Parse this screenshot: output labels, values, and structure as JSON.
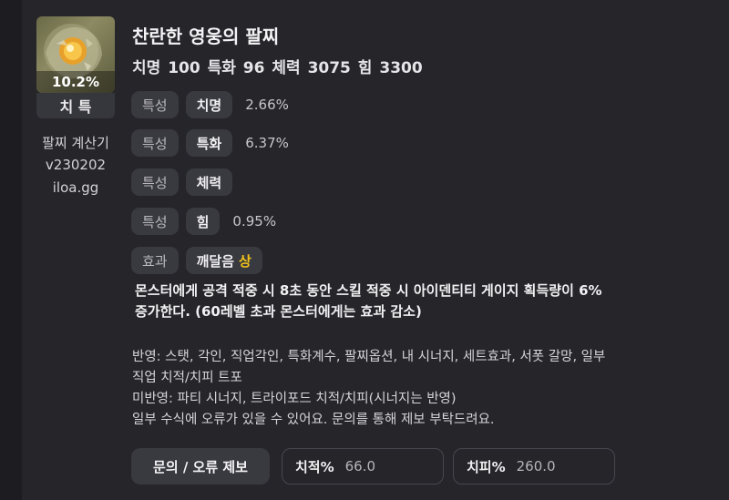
{
  "item": {
    "icon": "bracelet-gem-icon",
    "percent": "10.2%",
    "abbr": "치 특",
    "name": "찬란한 영웅의 팔찌",
    "stats": "치명 100   특화 96   체력 3075   힘 3300"
  },
  "sidebar": {
    "line1": "팔찌 계산기",
    "line2": "v230202",
    "line3": "iloa.gg"
  },
  "rows": [
    {
      "tag": "특성",
      "chip": "치명",
      "value": "2.66%"
    },
    {
      "tag": "특성",
      "chip": "특화",
      "value": "6.37%"
    },
    {
      "tag": "특성",
      "chip": "체력",
      "value": ""
    },
    {
      "tag": "특성",
      "chip": "힘",
      "value": "0.95%"
    }
  ],
  "effect_row": {
    "tag": "효과",
    "chip": "깨달음",
    "grade": "상",
    "grade_color": "#f2c318"
  },
  "effect_text": {
    "line1": "몬스터에게 공격 적중 시 8초 동안 스킬 적중 시 아이덴티티 게이지 획득량이 6%",
    "line2": "증가한다. (60레벨 초과 몬스터에게는 효과 감소)"
  },
  "notes": {
    "line1": "반영: 스탯, 각인, 직업각인, 특화계수, 팔찌옵션, 내 시너지, 세트효과, 서폿 갈망, 일부",
    "line2": "직업 치적/치피 트포",
    "line3": "미반영: 파티 시너지, 트라이포드 치적/치피(시너지는 반영)",
    "line4": "일부 수식에 오류가 있을 수 있어요. 문의를 통해 제보 부탁드려요."
  },
  "footer": {
    "report_button": "문의 / 오류 제보",
    "crit_rate_label": "치적%",
    "crit_rate_value": "66.0",
    "crit_dmg_label": "치피%",
    "crit_dmg_value": "260.0"
  }
}
